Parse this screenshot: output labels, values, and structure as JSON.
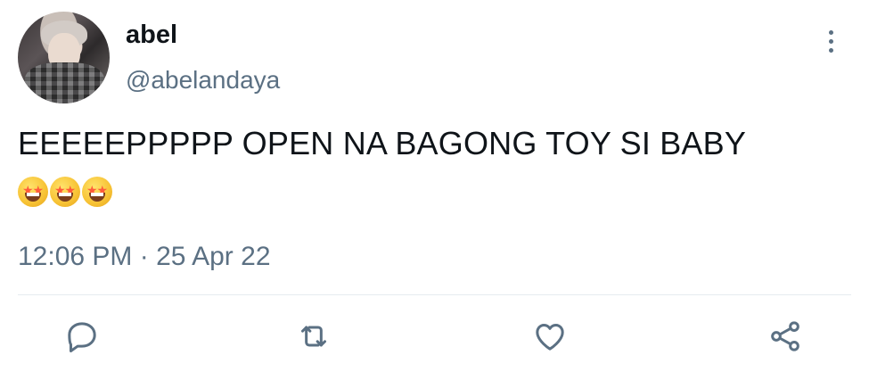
{
  "tweet": {
    "display_name": "abel",
    "handle": "@abelandaya",
    "text": "EEEEEPPPPP OPEN NA BAGONG TOY SI BABY",
    "emojis": [
      "star-struck",
      "star-struck",
      "star-struck"
    ],
    "timestamp": "12:06 PM · 25 Apr 22"
  },
  "icons": {
    "more": "more-vertical-icon",
    "reply": "reply-icon",
    "retweet": "retweet-icon",
    "like": "heart-icon",
    "share": "share-icon"
  },
  "colors": {
    "text": "#0f1419",
    "secondary": "#5b7083",
    "divider": "#e6ecf0"
  }
}
